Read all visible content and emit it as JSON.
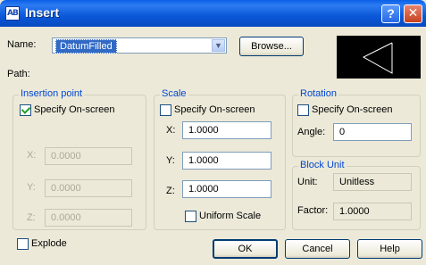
{
  "window": {
    "title": "Insert",
    "help_glyph": "?",
    "close_glyph": "✕",
    "icon_text": "AB"
  },
  "name": {
    "label": "Name:",
    "value": "DatumFilled",
    "browse_label": "Browse..."
  },
  "path": {
    "label": "Path:"
  },
  "insertion": {
    "title": "Insertion point",
    "specify_label": "Specify On-screen",
    "specify_checked": true,
    "x_label": "X:",
    "x_value": "0.0000",
    "y_label": "Y:",
    "y_value": "0.0000",
    "z_label": "Z:",
    "z_value": "0.0000"
  },
  "scale": {
    "title": "Scale",
    "specify_label": "Specify On-screen",
    "specify_checked": false,
    "x_label": "X:",
    "x_value": "1.0000",
    "y_label": "Y:",
    "y_value": "1.0000",
    "z_label": "Z:",
    "z_value": "1.0000",
    "uniform_label": "Uniform Scale",
    "uniform_checked": false
  },
  "rotation": {
    "title": "Rotation",
    "specify_label": "Specify On-screen",
    "specify_checked": false,
    "angle_label": "Angle:",
    "angle_value": "0"
  },
  "block_unit": {
    "title": "Block Unit",
    "unit_label": "Unit:",
    "unit_value": "Unitless",
    "factor_label": "Factor:",
    "factor_value": "1.0000"
  },
  "explode": {
    "label": "Explode",
    "checked": false
  },
  "buttons": {
    "ok": "OK",
    "cancel": "Cancel",
    "help": "Help"
  },
  "colors": {
    "titlebar": "#0a5fe6",
    "group_title": "#0046d5",
    "preview_bg": "#000000",
    "selection": "#316ac5"
  },
  "icons": {
    "close": "close-icon",
    "help": "help-icon",
    "dropdown": "chevron-down-icon",
    "checkmark": "checkmark-icon"
  }
}
